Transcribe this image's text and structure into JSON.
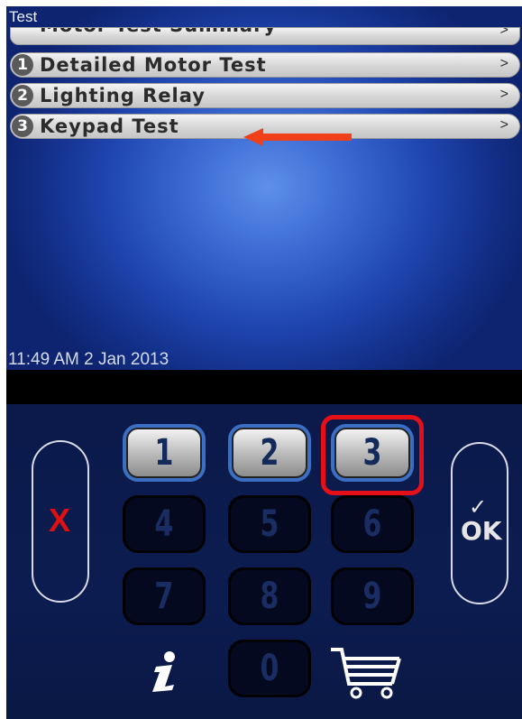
{
  "screen": {
    "title": "Test",
    "menu": [
      {
        "number": "",
        "label": "Motor Test Summary",
        "chevron": ">"
      },
      {
        "number": "1",
        "label": "Detailed Motor Test",
        "chevron": ">"
      },
      {
        "number": "2",
        "label": "Lighting Relay",
        "chevron": ">"
      },
      {
        "number": "3",
        "label": "Keypad Test",
        "chevron": ">"
      }
    ],
    "datetime": "11:49 AM 2 Jan 2013"
  },
  "keypad": {
    "keys": [
      "1",
      "2",
      "3",
      "4",
      "5",
      "6",
      "7",
      "8",
      "9",
      "0"
    ],
    "active_keys": [
      "1",
      "2",
      "3"
    ],
    "highlighted_key": "3",
    "cancel_label": "X",
    "ok_check": "✓",
    "ok_label": "OK",
    "info_icon": "info-icon",
    "cart_icon": "cart-icon"
  },
  "colors": {
    "screen_blue": "#2a55c2",
    "panel_navy": "#0b1a4a",
    "annotation_red": "#e40f17",
    "arrow_red": "#f0401a"
  }
}
